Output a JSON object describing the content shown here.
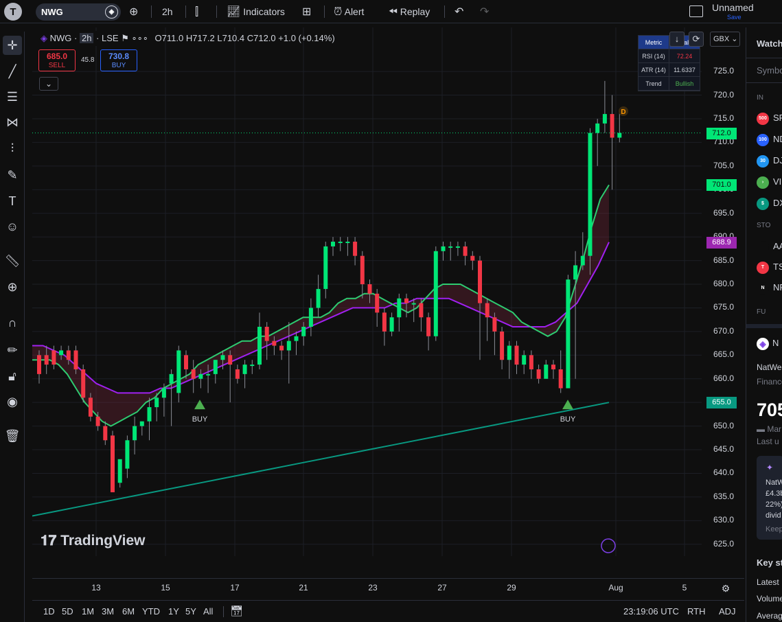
{
  "topbar": {
    "logo": "T",
    "symbol": "NWG",
    "add_icon": "plus-circle-icon",
    "interval": "2h",
    "chart_type_icon": "candles-icon",
    "indicators_label": "Indicators",
    "alert_label": "Alert",
    "replay_label": "Replay",
    "layout_name": "Unnamed",
    "save_label": "Save"
  },
  "legend": {
    "symbol": "NWG",
    "interval": "2h",
    "exchange": "LSE",
    "ohlc": "O711.0  H717.2  L710.4  C712.0  +1.0 (+0.14%)",
    "sell_price": "685.0",
    "sell_label": "SELL",
    "spread": "45.8",
    "buy_price": "730.8",
    "buy_label": "BUY"
  },
  "metric_table": {
    "header": [
      "Metric",
      "Val"
    ],
    "rows": [
      {
        "metric": "RSI (14)",
        "value": "72.24",
        "color": "#f23645"
      },
      {
        "metric": "ATR (14)",
        "value": "11.6337",
        "color": "#d1d4dc"
      },
      {
        "metric": "Trend",
        "value": "Bullish",
        "color": "#4caf50"
      }
    ]
  },
  "currency": "GBX",
  "price_axis": [
    "725.0",
    "720.0",
    "715.0",
    "710.0",
    "705.0",
    "700.0",
    "695.0",
    "690.0",
    "685.0",
    "680.0",
    "675.0",
    "670.0",
    "665.0",
    "660.0",
    "655.0",
    "650.0",
    "645.0",
    "640.0",
    "635.0",
    "630.0",
    "625.0"
  ],
  "price_tags": [
    {
      "value": "712.0",
      "bg": "#00e676",
      "fg": "#0f0f0f"
    },
    {
      "value": "701.0",
      "bg": "#00e676",
      "fg": "#0f0f0f"
    },
    {
      "value": "688.9",
      "bg": "#9c27b0",
      "fg": "#ffffff"
    },
    {
      "value": "655.0",
      "bg": "#089981",
      "fg": "#ffffff"
    }
  ],
  "date_axis": [
    "13",
    "15",
    "17",
    "21",
    "23",
    "27",
    "29",
    "Aug",
    "5"
  ],
  "signals": [
    {
      "label": "BUY"
    },
    {
      "label": "BUY"
    }
  ],
  "dividend_marker": "D",
  "watermark": "TradingView",
  "bottombar": {
    "ranges": [
      "1D",
      "5D",
      "1M",
      "3M",
      "6M",
      "YTD",
      "1Y",
      "5Y",
      "All"
    ],
    "time": "23:19:06 UTC",
    "session": "RTH",
    "adj": "ADJ"
  },
  "right_panel": {
    "title": "Watch",
    "column": "Symbo",
    "section1": "IN",
    "items": [
      {
        "badge": "500",
        "color": "#f23645",
        "text": "SF"
      },
      {
        "badge": "100",
        "color": "#2962ff",
        "text": "ND"
      },
      {
        "badge": "30",
        "color": "#2196f3",
        "text": "DJ"
      },
      {
        "badge": "›",
        "color": "#4caf50",
        "text": "VI"
      },
      {
        "badge": "$",
        "color": "#089981",
        "text": "DX"
      }
    ],
    "section2": "STO",
    "stocks": [
      {
        "badge": "",
        "color": "#0f0f0f",
        "text": "AA"
      },
      {
        "badge": "T",
        "color": "#f23645",
        "text": "TS"
      },
      {
        "badge": "N",
        "color": "#0f0f0f",
        "text": "NF"
      }
    ],
    "section3": "FU",
    "detail_symbol": "N",
    "detail_name": "NatWes",
    "detail_sub": "Finance",
    "detail_price": "705",
    "detail_market": "Mar",
    "detail_last": "Last u",
    "news": [
      "NatW",
      "£4.3b",
      "22%).",
      "divid",
      "Keep"
    ],
    "key_stats": "Key st",
    "stats": [
      "Latest",
      "Volume",
      "Averag"
    ]
  },
  "chart_data": {
    "type": "candlestick",
    "ylim": [
      622.5,
      728.5
    ],
    "candles": [
      [
        665,
        661,
        666,
        659
      ],
      [
        665,
        663,
        667,
        661
      ],
      [
        666,
        663,
        667,
        662
      ],
      [
        665,
        666,
        667,
        664
      ],
      [
        666,
        664,
        667,
        663
      ],
      [
        666,
        662,
        667,
        661
      ],
      [
        662,
        656,
        663,
        655
      ],
      [
        656,
        652,
        657,
        651
      ],
      [
        652,
        650,
        653,
        649
      ],
      [
        650,
        647,
        651,
        646
      ],
      [
        648,
        636,
        649,
        636
      ],
      [
        638,
        643,
        641,
        637
      ],
      [
        641,
        647,
        648,
        639
      ],
      [
        647,
        650,
        652,
        644
      ],
      [
        650,
        651,
        651,
        648
      ],
      [
        651,
        654,
        656,
        647
      ],
      [
        654,
        656,
        657,
        651
      ],
      [
        656,
        658,
        659,
        652
      ],
      [
        659,
        661,
        662,
        650
      ],
      [
        657,
        666,
        667,
        655
      ],
      [
        665,
        662,
        666,
        660
      ],
      [
        662,
        660,
        664,
        657
      ],
      [
        660,
        661,
        662,
        658
      ],
      [
        661,
        661,
        663,
        657
      ],
      [
        661,
        664,
        664,
        659
      ],
      [
        664,
        665,
        666,
        662
      ],
      [
        665,
        663,
        666,
        655
      ],
      [
        662,
        660,
        663,
        659
      ],
      [
        661,
        663,
        664,
        658
      ],
      [
        663,
        663,
        664,
        661
      ],
      [
        663,
        671,
        674,
        662
      ],
      [
        671,
        668,
        672,
        664
      ],
      [
        668,
        667,
        669,
        665
      ],
      [
        667,
        666,
        668,
        664
      ],
      [
        666,
        668,
        672,
        659
      ],
      [
        668,
        669,
        670,
        665
      ],
      [
        669,
        671,
        672,
        667
      ],
      [
        671,
        675,
        677,
        669
      ],
      [
        675,
        679,
        682,
        673
      ],
      [
        679,
        688,
        689,
        677
      ],
      [
        688,
        689,
        690,
        686
      ],
      [
        689,
        689,
        690,
        687
      ],
      [
        689,
        689,
        690,
        686
      ],
      [
        689,
        686,
        690,
        684
      ],
      [
        686,
        680,
        687,
        677
      ],
      [
        680,
        678,
        681,
        676
      ],
      [
        678,
        674,
        679,
        671
      ],
      [
        674,
        670,
        675,
        667
      ],
      [
        670,
        673,
        674,
        669
      ],
      [
        673,
        677,
        678,
        670
      ],
      [
        677,
        676,
        678,
        673
      ],
      [
        676,
        676,
        677,
        672
      ],
      [
        676,
        673,
        677,
        670
      ],
      [
        673,
        669,
        674,
        666
      ],
      [
        669,
        687,
        688,
        668
      ],
      [
        687,
        688,
        689,
        685
      ],
      [
        688,
        688,
        689,
        685
      ],
      [
        688,
        688,
        689,
        686
      ],
      [
        688,
        686,
        689,
        684
      ],
      [
        686,
        685,
        687,
        683
      ],
      [
        685,
        676,
        686,
        664
      ],
      [
        676,
        673,
        677,
        668
      ],
      [
        673,
        670,
        674,
        665
      ],
      [
        670,
        664,
        671,
        662
      ],
      [
        664,
        667,
        668,
        660
      ],
      [
        667,
        663,
        668,
        661
      ],
      [
        663,
        665,
        666,
        661
      ],
      [
        665,
        662,
        666,
        660
      ],
      [
        662,
        660,
        663,
        659
      ],
      [
        660,
        663,
        664,
        661
      ],
      [
        663,
        662,
        664,
        660
      ],
      [
        662,
        658,
        666,
        657
      ],
      [
        658,
        681,
        682,
        665
      ],
      [
        681,
        684,
        687,
        660
      ],
      [
        684,
        686,
        691,
        683
      ],
      [
        686,
        712,
        713,
        682
      ],
      [
        712,
        714,
        715,
        705
      ],
      [
        714,
        716,
        723,
        712
      ],
      [
        716,
        711,
        720,
        700
      ],
      [
        711,
        712,
        717,
        710
      ]
    ],
    "fast_line": [
      664,
      664,
      664,
      663,
      661,
      658,
      655,
      653,
      651,
      650,
      651,
      652,
      653,
      655,
      656,
      658,
      659,
      660,
      661,
      663,
      664,
      665,
      666,
      667,
      668,
      668,
      669,
      669,
      670,
      671,
      672,
      673,
      673,
      673,
      674,
      676,
      677,
      677,
      678,
      678,
      677,
      676,
      675,
      674,
      675,
      677,
      679,
      680,
      680,
      680,
      679,
      678,
      677,
      676,
      675,
      674,
      672,
      671,
      670,
      669,
      670,
      673,
      679,
      685,
      692,
      698,
      701
    ],
    "slow_line": [
      667,
      667,
      666,
      665,
      663,
      661,
      659,
      658,
      657,
      657,
      657,
      657,
      658,
      658,
      659,
      660,
      661,
      662,
      663,
      664,
      665,
      666,
      667,
      668,
      669,
      670,
      671,
      672,
      673,
      674,
      675,
      675,
      675,
      675,
      676,
      676,
      677,
      677,
      677,
      677,
      676,
      675,
      674,
      673,
      672,
      671,
      671,
      671,
      671,
      672,
      674,
      676,
      680,
      684,
      688.9
    ],
    "ema_line": [
      631,
      632,
      633,
      634,
      635,
      636,
      637,
      638,
      639,
      640,
      641,
      642,
      643,
      644,
      645,
      646,
      647,
      648,
      649,
      650,
      651,
      652,
      653,
      654,
      655
    ]
  }
}
